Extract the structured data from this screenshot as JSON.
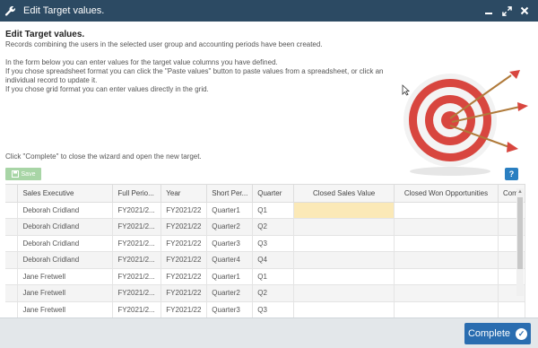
{
  "window": {
    "title": "Edit Target values.",
    "icons": [
      "wrench-icon",
      "minimize-icon",
      "maximize-icon",
      "close-icon"
    ]
  },
  "intro": {
    "heading": "Edit Target values.",
    "line1": "Records combining the users in the selected user group and accounting periods have been created.",
    "line2": "In the form below you can enter values for the target value columns you have defined.",
    "line3": "If you chose spreadsheet format you can click the \"Paste values\" button to paste values from a spreadsheet, or click an individual record to update it.",
    "line4": "If you chose grid format you can enter values directly in the grid.",
    "complete_note": "Click \"Complete\" to close the wizard and open the new target."
  },
  "toolbar": {
    "save_label": "Save",
    "help_label": "?"
  },
  "grid": {
    "columns": [
      "Sales Executive",
      "Full Perio...",
      "Year",
      "Short Per...",
      "Quarter",
      "Closed Sales Value",
      "Closed Won Opportunities",
      "Comm"
    ],
    "rows": [
      [
        "Deborah Cridland",
        "FY2021/2...",
        "FY2021/22",
        "Quarter1",
        "Q1",
        "",
        "",
        ""
      ],
      [
        "Deborah Cridland",
        "FY2021/2...",
        "FY2021/22",
        "Quarter2",
        "Q2",
        "",
        "",
        ""
      ],
      [
        "Deborah Cridland",
        "FY2021/2...",
        "FY2021/22",
        "Quarter3",
        "Q3",
        "",
        "",
        ""
      ],
      [
        "Deborah Cridland",
        "FY2021/2...",
        "FY2021/22",
        "Quarter4",
        "Q4",
        "",
        "",
        ""
      ],
      [
        "Jane Fretwell",
        "FY2021/2...",
        "FY2021/22",
        "Quarter1",
        "Q1",
        "",
        "",
        ""
      ],
      [
        "Jane Fretwell",
        "FY2021/2...",
        "FY2021/22",
        "Quarter2",
        "Q2",
        "",
        "",
        ""
      ],
      [
        "Jane Fretwell",
        "FY2021/2...",
        "FY2021/22",
        "Quarter3",
        "Q3",
        "",
        "",
        ""
      ]
    ]
  },
  "footer": {
    "complete_label": "Complete"
  },
  "colors": {
    "titlebar": "#2c4a63",
    "accent": "#2a6db0",
    "highlight_cell": "#fbe9b7",
    "save_button": "#a8d5a6"
  }
}
